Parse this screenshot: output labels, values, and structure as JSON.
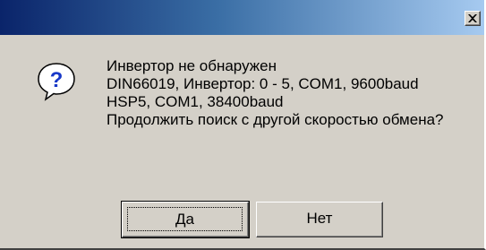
{
  "window": {
    "title": "",
    "close_glyph": "×"
  },
  "icon": {
    "name": "question-icon",
    "glyph": "?"
  },
  "message": {
    "lines": [
      "Инвертор не обнаружен",
      "DIN66019, Инвертор: 0 - 5, COM1, 9600baud",
      "HSP5, COM1, 38400baud",
      "Продолжить поиск с другой скоростью обмена?"
    ]
  },
  "buttons": {
    "yes_label": "Да",
    "no_label": "Нет"
  },
  "colors": {
    "title_gradient_start": "#0a246a",
    "title_gradient_end": "#a6caf0",
    "face": "#d4d0c8",
    "icon_blue": "#1838c8"
  }
}
